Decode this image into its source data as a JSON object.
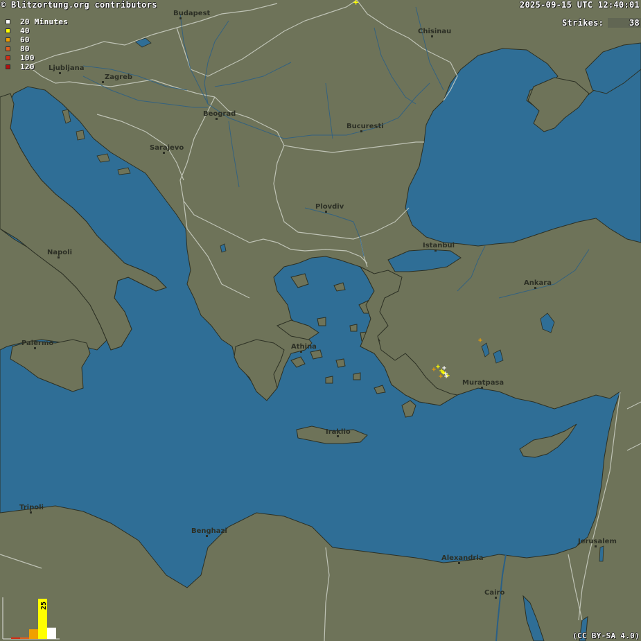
{
  "header": {
    "credit": "© Blitzortung.org contributors",
    "timestamp": "2025-09-15 UTC 12:40:01"
  },
  "strikes": {
    "label": "Strikes:",
    "count": "38"
  },
  "legend": {
    "items": [
      {
        "label": "20 Minutes",
        "color": "#ffffff"
      },
      {
        "label": "40",
        "color": "#ffff00"
      },
      {
        "label": "60",
        "color": "#f0a000"
      },
      {
        "label": "80",
        "color": "#e06020"
      },
      {
        "label": "100",
        "color": "#d03018"
      },
      {
        "label": "120",
        "color": "#b01010"
      }
    ]
  },
  "license": "(CC BY-SA 4.0)",
  "histogram": {
    "max_label": "25",
    "bars": [
      {
        "value": 1,
        "color": "#d03018"
      },
      {
        "value": 1,
        "color": "#e06020"
      },
      {
        "value": 6,
        "color": "#f0a000"
      },
      {
        "value": 25,
        "color": "#ffff00"
      },
      {
        "value": 7,
        "color": "#ffffff"
      }
    ]
  },
  "cities": [
    {
      "name": "Budapest"
    },
    {
      "name": "Chisinau"
    },
    {
      "name": "Ljubljana"
    },
    {
      "name": "Zagreb"
    },
    {
      "name": "Beograd"
    },
    {
      "name": "Bucuresti"
    },
    {
      "name": "Sarajevo"
    },
    {
      "name": "Plovdiv"
    },
    {
      "name": "Istanbul"
    },
    {
      "name": "Ankara"
    },
    {
      "name": "Napoli"
    },
    {
      "name": "Palermo"
    },
    {
      "name": "Athina"
    },
    {
      "name": "Muratpasa"
    },
    {
      "name": "Iraklio"
    },
    {
      "name": "Tripoli"
    },
    {
      "name": "Benghazi"
    },
    {
      "name": "Alexandria"
    },
    {
      "name": "Jerusalem"
    },
    {
      "name": "Cairo"
    }
  ],
  "colors": {
    "land": "#6e7359",
    "sea": "#2f6e96",
    "border": "#c8ccc0",
    "river": "#2a5f86",
    "coast": "#2c3024"
  }
}
